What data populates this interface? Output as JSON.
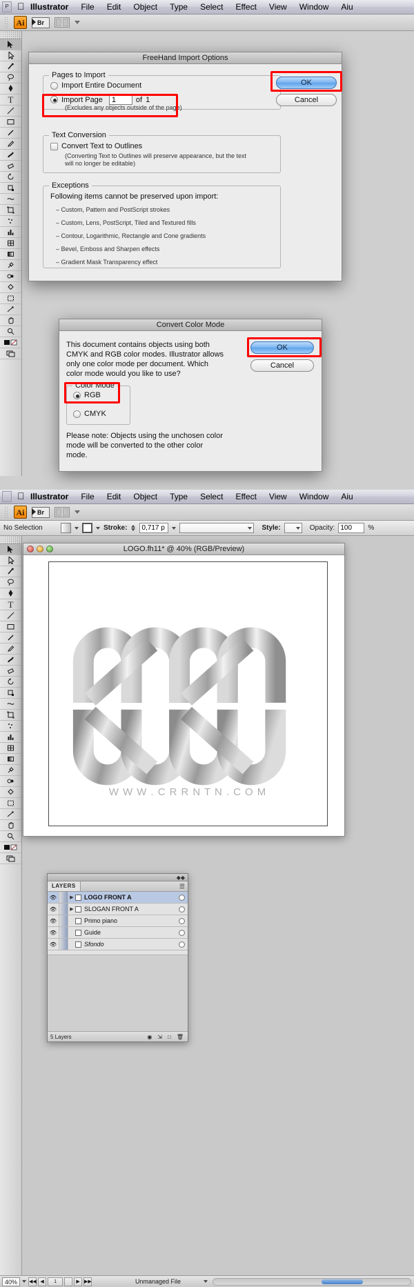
{
  "menubar": {
    "apple_icon": "apple-logo",
    "app_name": "Illustrator",
    "items": [
      "File",
      "Edit",
      "Object",
      "Type",
      "Select",
      "Effect",
      "View",
      "Window",
      "Aiu"
    ]
  },
  "apptoolbar": {
    "ai_badge": "Ai",
    "bridge_badge": "Br",
    "arrange_icon": "arrange-documents-icon",
    "chevron": "chevron-down-icon"
  },
  "freehand_dialog": {
    "title": "FreeHand Import Options",
    "pages_group": {
      "label": "Pages to Import",
      "option_entire": "Import Entire Document",
      "option_page": "Import Page",
      "page_value": "1",
      "of_label": "of",
      "page_total": "1",
      "hint": "(Excludes any objects outside of the page)"
    },
    "text_conversion": {
      "label": "Text Conversion",
      "checkbox_label": "Convert Text to Outlines",
      "hint_line1": "(Converting Text to Outlines will preserve appearance, but the text",
      "hint_line2": "will no longer be editable)"
    },
    "exceptions": {
      "label": "Exceptions",
      "heading": "Following items cannot be preserved upon import:",
      "items": [
        "– Custom, Pattern and PostScript strokes",
        "– Custom, Lens, PostScript, Tiled and Textured fills",
        "– Contour, Logarithmic, Rectangle and Cone gradients",
        "– Bevel, Emboss and Sharpen effects",
        "– Gradient Mask Transparency effect"
      ]
    },
    "ok_label": "OK",
    "cancel_label": "Cancel"
  },
  "color_dialog": {
    "title": "Convert Color Mode",
    "message_line1": "This document contains objects using both",
    "message_line2": "CMYK and RGB color modes.  Illustrator allows",
    "message_line3": "only one color mode per document.  Which",
    "message_line4": "color mode would you like to use?",
    "group_label": "Color Mode",
    "option_rgb": "RGB",
    "option_cmyk": "CMYK",
    "note_line1": "Please note: Objects using the unchosen color",
    "note_line2": "mode will be converted to the other color",
    "note_line3": "mode.",
    "ok_label": "OK",
    "cancel_label": "Cancel"
  },
  "controlbar": {
    "selection_state": "No Selection",
    "stroke_label": "Stroke:",
    "stroke_value": "0,717 p",
    "style_label": "Style:",
    "opacity_label": "Opacity:",
    "opacity_value": "100",
    "opacity_unit": "%"
  },
  "document": {
    "title": "LOGO.fh11* @ 40% (RGB/Preview)",
    "logo_text": "W W W . C R R N T N . C O M"
  },
  "layers_panel": {
    "tab_label": "LAYERS",
    "rows": [
      {
        "name": "LOGO FRONT A",
        "selected": true,
        "expandable": true
      },
      {
        "name": "SLOGAN FRONT A",
        "selected": false,
        "expandable": true
      },
      {
        "name": "Primo piano",
        "selected": false,
        "expandable": false
      },
      {
        "name": "Guide",
        "selected": false,
        "expandable": false
      },
      {
        "name": "Sfondo",
        "selected": false,
        "expandable": false
      }
    ],
    "footer_count": "5 Layers"
  },
  "statusbar": {
    "zoom": "40%",
    "page_value": "1",
    "status_text": "Unmanaged File"
  },
  "colors": {
    "highlight_red": "#ff0000",
    "default_button_blue": "#5fa3ea",
    "selected_layer_blue": "#b9c9e4"
  }
}
